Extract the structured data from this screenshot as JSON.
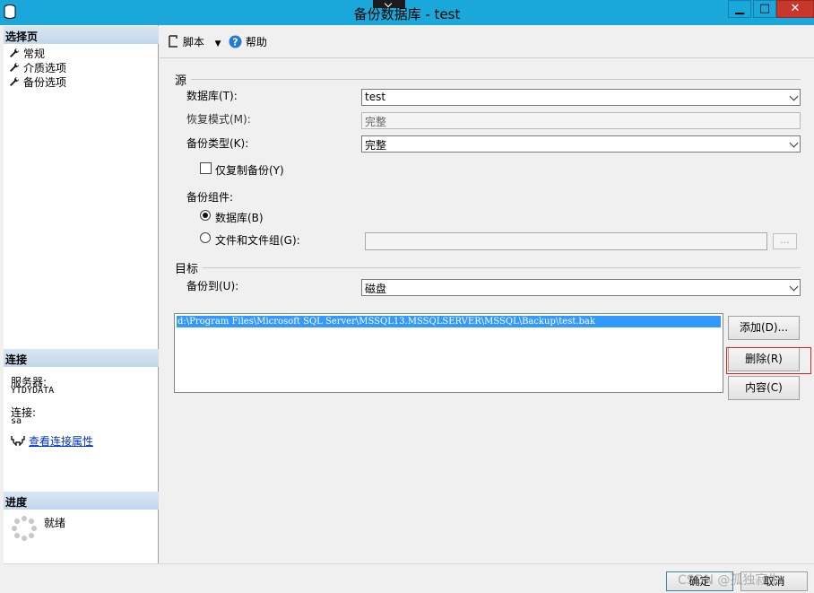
{
  "window": {
    "title": "备份数据库 - test",
    "controls": {
      "minimize": "▁",
      "maximize": "□",
      "close": "✕"
    }
  },
  "left": {
    "select_page_header": "选择页",
    "pages": [
      {
        "label": "常规"
      },
      {
        "label": "介质选项"
      },
      {
        "label": "备份选项"
      }
    ],
    "connection_header": "连接",
    "server_label": "服务器:",
    "server_value": "YTDYDATA",
    "connection_label": "连接:",
    "connection_value": "sa",
    "view_props_link": "查看连接属性",
    "progress_header": "进度",
    "progress_status": "就绪"
  },
  "toolbar": {
    "script_label": "脚本",
    "help_label": "帮助"
  },
  "source": {
    "group_label": "源",
    "database_label": "数据库(T):",
    "database_value": "test",
    "recovery_label": "恢复模式(M):",
    "recovery_value": "完整",
    "backup_type_label": "备份类型(K):",
    "backup_type_value": "完整",
    "copy_only_label": "仅复制备份(Y)",
    "copy_only_checked": false,
    "component_label": "备份组件:",
    "component_database_label": "数据库(B)",
    "component_files_label": "文件和文件组(G):",
    "component_selected": "database",
    "files_browse_label": "..."
  },
  "destination": {
    "group_label": "目标",
    "backup_to_label": "备份到(U):",
    "backup_to_value": "磁盘",
    "files": [
      "d:\\Program Files\\Microsoft SQL Server\\MSSQL13.MSSQLSERVER\\MSSQL\\Backup\\test.bak"
    ],
    "add_label": "添加(D)...",
    "remove_label": "删除(R)",
    "contents_label": "内容(C)"
  },
  "footer": {
    "ok_label": "确定",
    "cancel_label": "取消",
    "watermark": "CSDN @孤独寂生"
  },
  "colors": {
    "titlebar": "#1aa7d9",
    "close_button": "#c7372b",
    "selection": "#3399ff",
    "highlight_box": "#e02020",
    "link": "#0033cc"
  },
  "icons": {
    "app": "database-icon",
    "page": "wrench-icon",
    "script": "script-icon",
    "help": "help-icon",
    "connection": "plug-icon",
    "progress": "spinner-icon"
  }
}
